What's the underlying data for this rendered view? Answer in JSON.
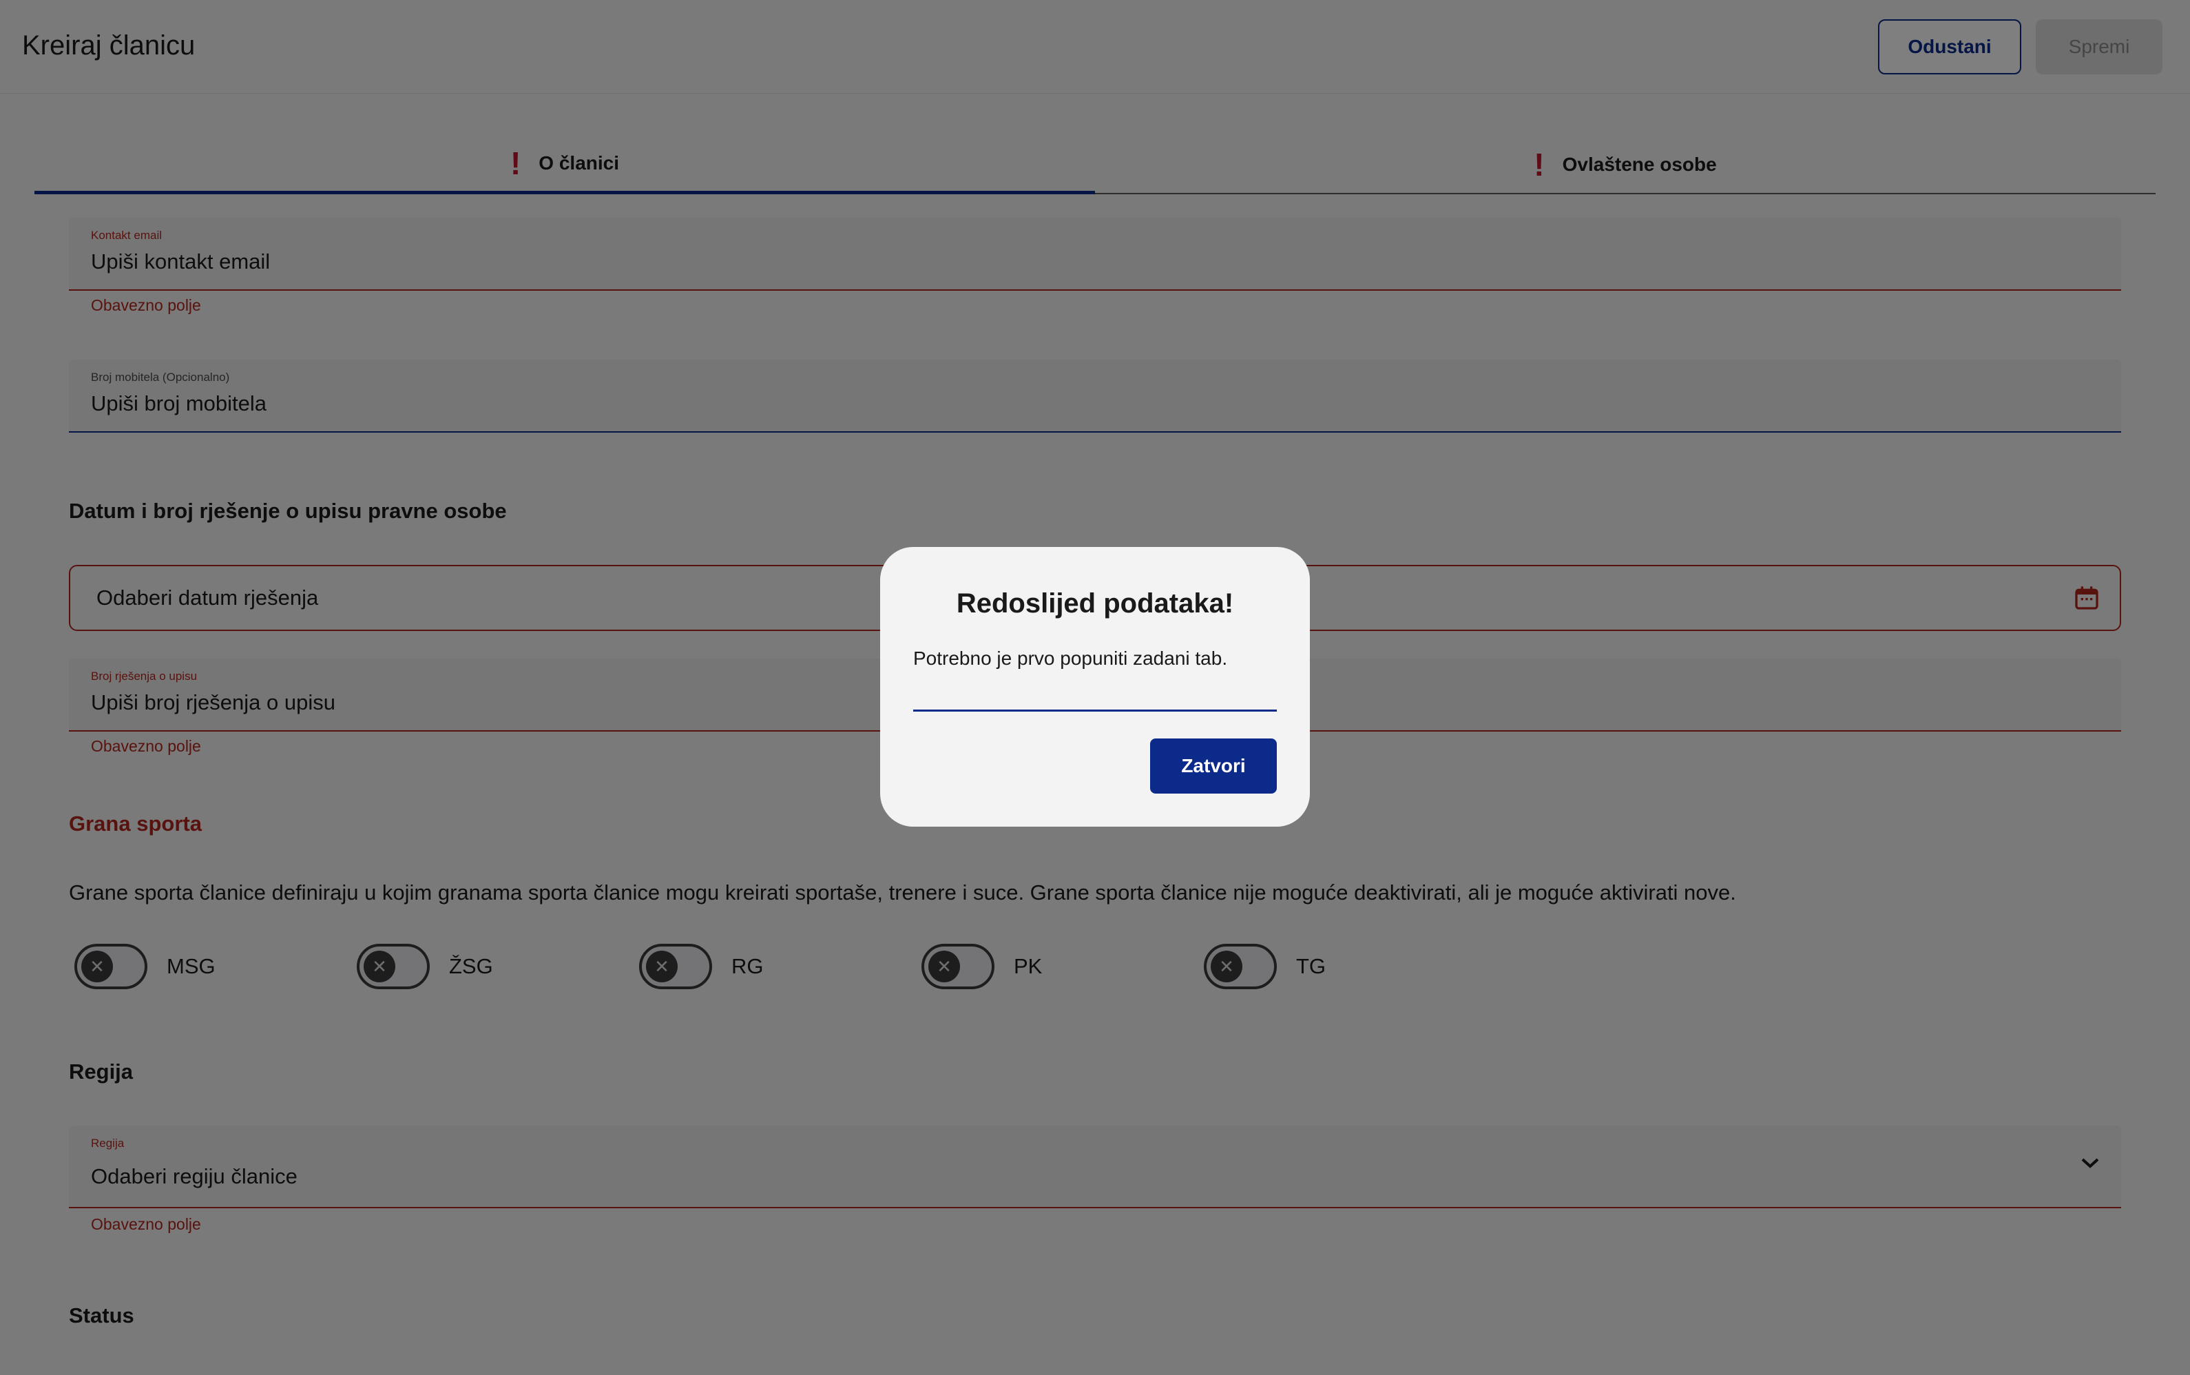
{
  "header": {
    "title": "Kreiraj članicu",
    "cancel_label": "Odustani",
    "save_label": "Spremi"
  },
  "tabs": [
    {
      "label": "O članici",
      "active": true,
      "warning": "!"
    },
    {
      "label": "Ovlaštene osobe",
      "active": false,
      "warning": "!"
    }
  ],
  "form": {
    "contact_email": {
      "label": "Kontakt email",
      "placeholder": "Upiši kontakt email",
      "error": "Obavezno polje"
    },
    "mobile": {
      "label": "Broj mobitela (Opcionalno)",
      "placeholder": "Upiši broj mobitela"
    },
    "decision_section_title": "Datum i broj rješenje o upisu pravne osobe",
    "decision_date": {
      "placeholder": "Odaberi datum rješenja",
      "icon": "calendar-icon"
    },
    "decision_number": {
      "label": "Broj rješenja o upisu",
      "placeholder": "Upiši broj rješenja o upisu",
      "error": "Obavezno polje"
    },
    "sport_section_title": "Grana sporta",
    "sport_description": "Grane sporta članice definiraju u kojim granama sporta članice mogu kreirati sportaše, trenere i suce. Grane sporta članice nije moguće deaktivirati, ali je moguće aktivirati nove.",
    "sports": [
      {
        "label": "MSG",
        "enabled": false
      },
      {
        "label": "ŽSG",
        "enabled": false
      },
      {
        "label": "RG",
        "enabled": false
      },
      {
        "label": "PK",
        "enabled": false
      },
      {
        "label": "TG",
        "enabled": false
      }
    ],
    "region_section_title": "Regija",
    "region": {
      "label": "Regija",
      "placeholder": "Odaberi regiju članice",
      "error": "Obavezno polje"
    },
    "status_section_title": "Status"
  },
  "dialog": {
    "title": "Redoslijed podataka!",
    "message": "Potrebno je prvo popuniti zadani tab.",
    "close_label": "Zatvori"
  },
  "colors": {
    "primary": "#0b2a8a",
    "error": "#b3261e",
    "warning_icon": "#c0192f"
  }
}
